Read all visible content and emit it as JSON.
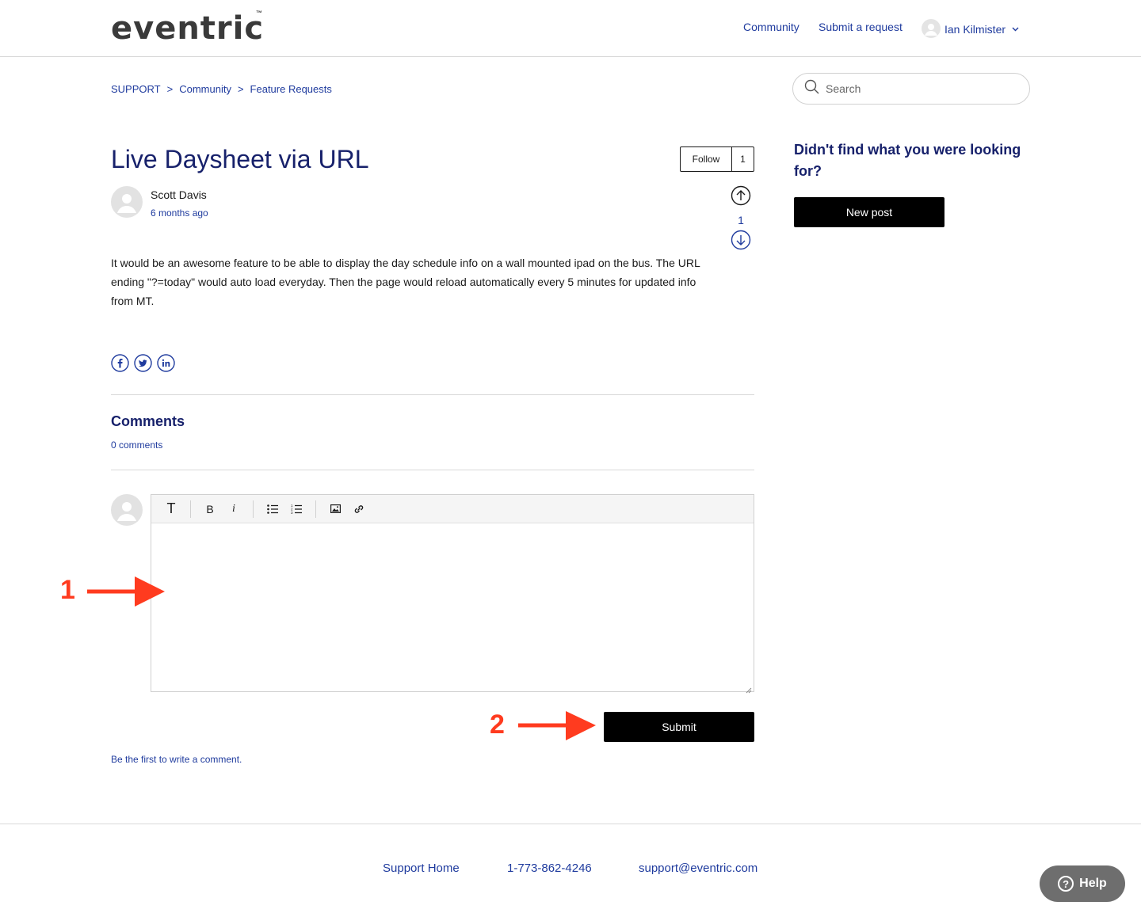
{
  "header": {
    "logo": "eventric",
    "logo_tm": "™",
    "nav": {
      "community": "Community",
      "submit_request": "Submit a request"
    },
    "user_name": "Ian Kilmister",
    "user_chevron": "⌄"
  },
  "breadcrumbs": [
    "SUPPORT",
    "Community",
    "Feature Requests"
  ],
  "breadcrumb_sep": ">",
  "search": {
    "placeholder": "Search"
  },
  "post": {
    "title": "Live Daysheet via URL",
    "follow_label": "Follow",
    "follow_count": "1",
    "author": "Scott Davis",
    "time": "6 months ago",
    "vote_count": "1",
    "body": "It would be an awesome feature to be able to display the day schedule info on a wall mounted ipad on the bus. The URL ending \"?=today\" would auto load everyday. Then the page would reload automatically every 5 minutes for updated info from MT.",
    "share_icons": [
      "facebook-icon",
      "twitter-icon",
      "linkedin-icon"
    ]
  },
  "comments": {
    "title": "Comments",
    "count": "0 comments",
    "toolbar": [
      "text-format-icon",
      "bold-icon",
      "italic-icon",
      "bullet-list-icon",
      "numbered-list-icon",
      "image-icon",
      "link-icon"
    ],
    "bold_label": "B",
    "italic_label": "i",
    "text_label": "T",
    "submit": "Submit",
    "empty_text": "Be the first to write a comment."
  },
  "sidebar": {
    "title": "Didn't find what you were looking for?",
    "new_post": "New post"
  },
  "annotations": {
    "one": "1",
    "two": "2",
    "color": "#ff3b1f"
  },
  "footer": {
    "support_home": "Support Home",
    "phone": "1-773-862-4246",
    "email": "support@eventric.com",
    "help": "Help",
    "help_q": "?"
  },
  "colors": {
    "link": "#1f3b9e",
    "heading": "#17216b",
    "button": "#000000",
    "help": "#6e6e6e"
  }
}
